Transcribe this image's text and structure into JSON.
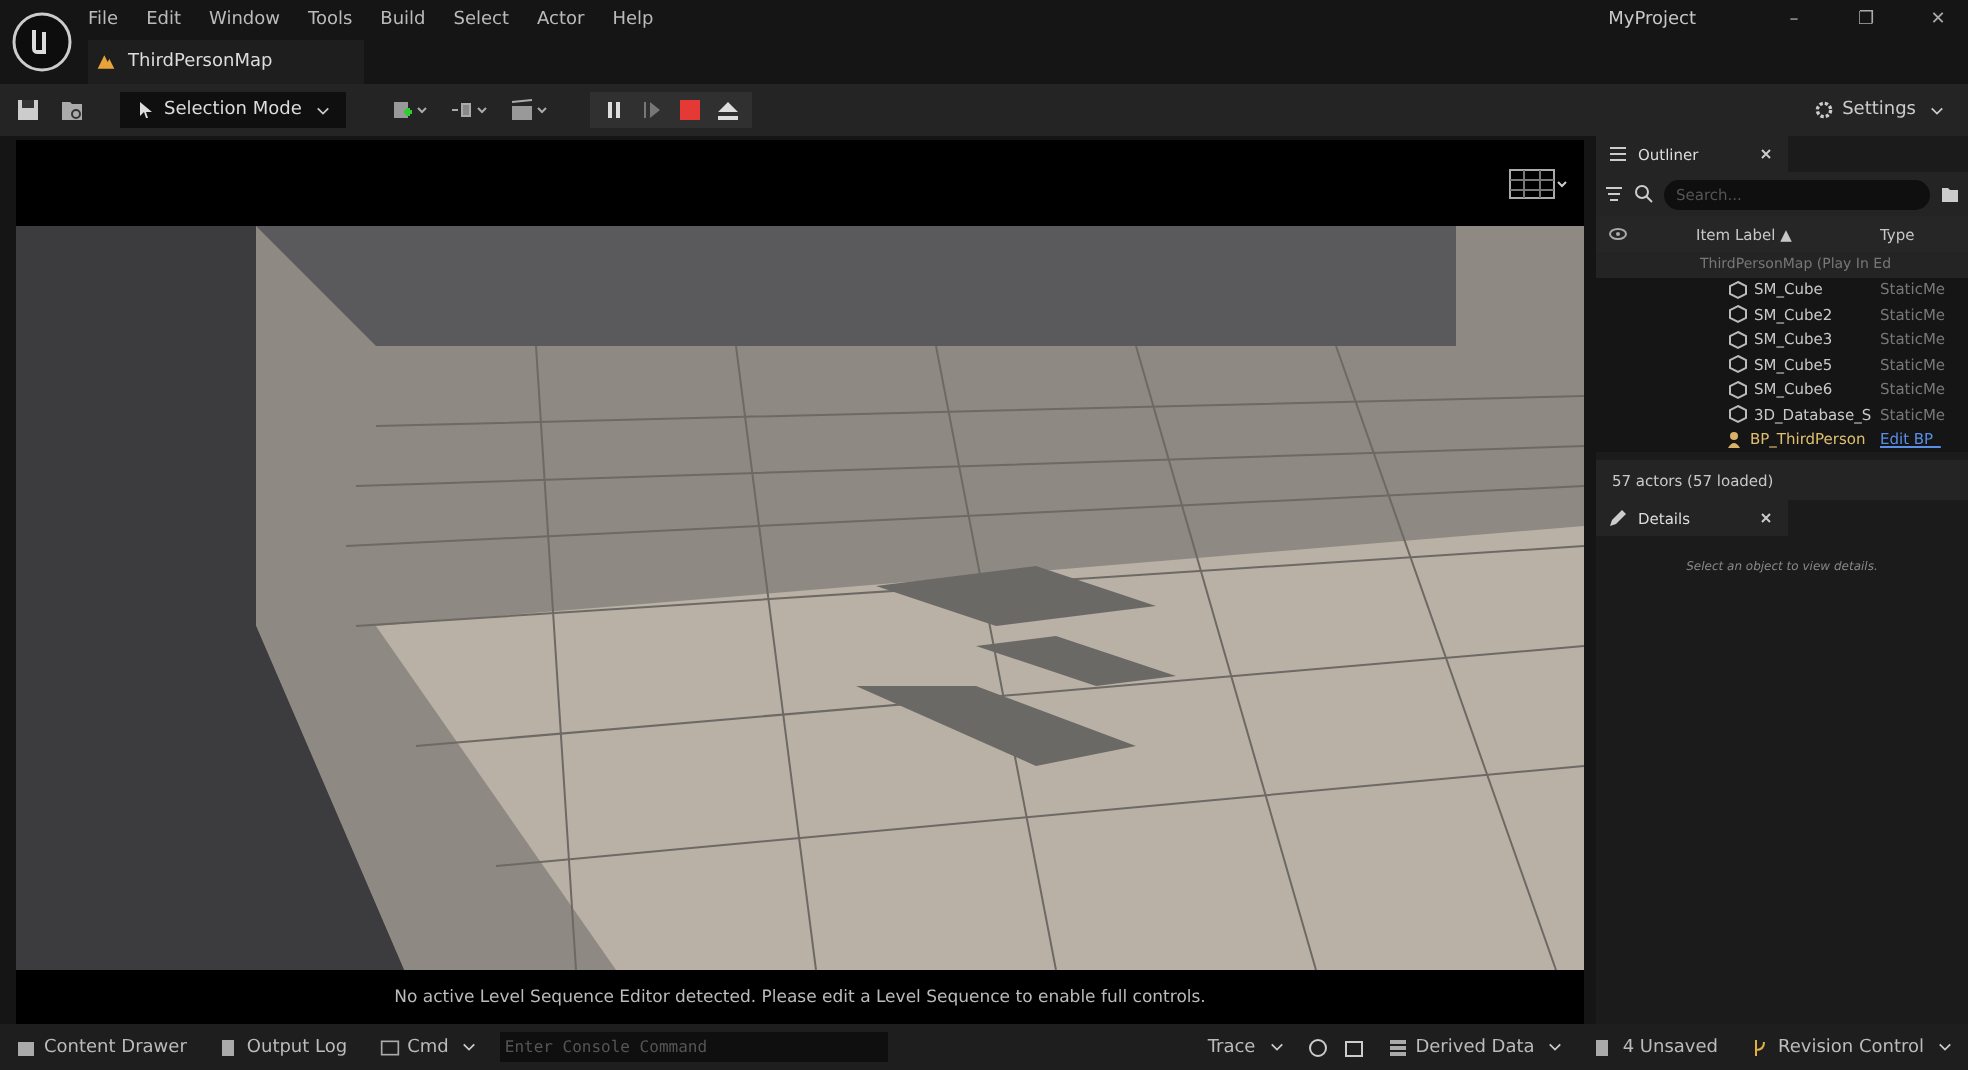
{
  "menu": [
    "File",
    "Edit",
    "Window",
    "Tools",
    "Build",
    "Select",
    "Actor",
    "Help"
  ],
  "project": "MyProject",
  "window_controls": [
    "–",
    "❐",
    "✕"
  ],
  "map_tab": {
    "label": "ThirdPersonMap"
  },
  "toolbar": {
    "mode": "Selection Mode",
    "settings": "Settings"
  },
  "viewport": {
    "message": "No active Level Sequence Editor detected. Please edit a Level Sequence to enable full controls."
  },
  "outliner": {
    "title": "Outliner",
    "search": {
      "placeholder": "Search..."
    },
    "columns": [
      "Item Label ▲",
      "Type"
    ],
    "tree": {
      "label": "ThirdPersonMap (Play In Ed",
      "children": [
        {
          "label": "SM_Cube",
          "type": "StaticMe",
          "kind": "mesh"
        },
        {
          "label": "SM_Cube2",
          "type": "StaticMe",
          "kind": "mesh"
        },
        {
          "label": "SM_Cube3",
          "type": "StaticMe",
          "kind": "mesh"
        },
        {
          "label": "SM_Cube5",
          "type": "StaticMe",
          "kind": "mesh"
        },
        {
          "label": "SM_Cube6",
          "type": "StaticMe",
          "kind": "mesh"
        },
        {
          "label": "3D_Database_S",
          "type": "StaticMe",
          "kind": "mesh"
        },
        {
          "label": "BP_ThirdPerson",
          "type": "Edit BP_",
          "kind": "pawn"
        }
      ]
    },
    "count": "57 actors (57 loaded)"
  },
  "details": {
    "title": "Details",
    "hint": "Select an object to view details."
  },
  "status_bar": {
    "content_drawer": "Content Drawer",
    "output_log": "Output Log",
    "cmd": "Cmd",
    "console": {
      "placeholder": "Enter Console Command"
    },
    "trace": "Trace",
    "derived_data": "Derived Data",
    "unsaved": "4 Unsaved",
    "revision": "Revision Control"
  }
}
